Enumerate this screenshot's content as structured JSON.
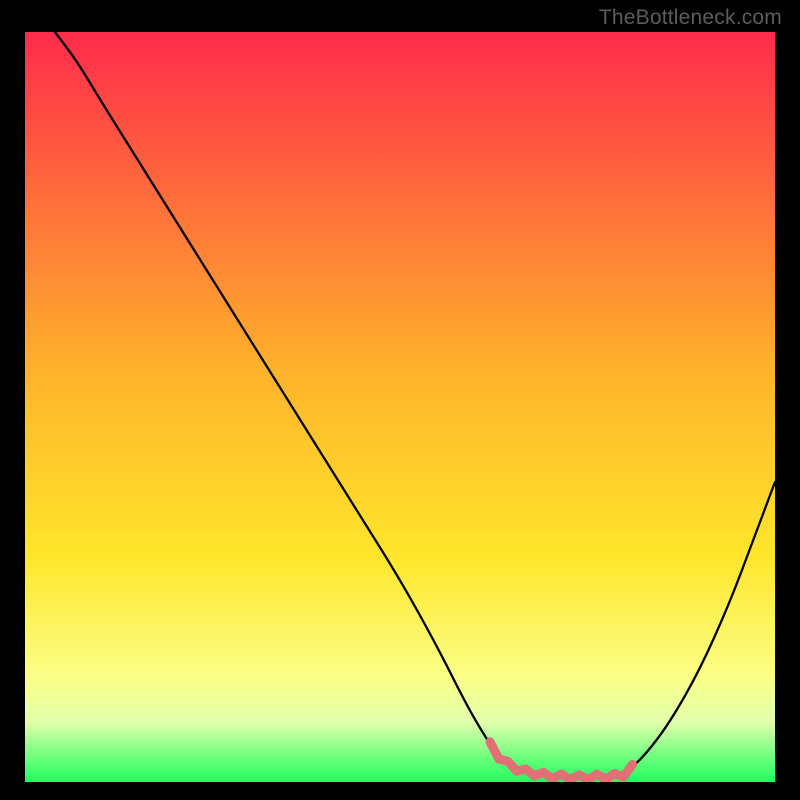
{
  "watermark": "TheBottleneck.com",
  "colors": {
    "gradient_stops": [
      {
        "offset": "0%",
        "color": "#ff2b4b"
      },
      {
        "offset": "45%",
        "color": "#ffb22b"
      },
      {
        "offset": "70%",
        "color": "#ffe62b"
      },
      {
        "offset": "86%",
        "color": "#fbff86"
      },
      {
        "offset": "92%",
        "color": "#e2ffac"
      },
      {
        "offset": "100%",
        "color": "#1dff5d"
      }
    ],
    "curve_stroke": "#000000",
    "valley_marker": "#e26e76"
  },
  "chart_data": {
    "type": "line",
    "title": "",
    "xlabel": "",
    "ylabel": "",
    "xlim": [
      0,
      100
    ],
    "ylim": [
      0,
      100
    ],
    "series": [
      {
        "name": "bottleneck-curve",
        "x": [
          4,
          7,
          10,
          15,
          20,
          25,
          30,
          35,
          40,
          45,
          50,
          55,
          59,
          62,
          63.5,
          65,
          67,
          70,
          74,
          79,
          80,
          81,
          83,
          86,
          90,
          94,
          97,
          100
        ],
        "y": [
          100,
          96,
          91,
          83,
          75,
          67,
          59,
          51,
          43,
          35,
          27,
          18,
          10,
          5,
          3,
          2,
          1.3,
          0.8,
          0.6,
          0.8,
          1.1,
          2,
          4,
          8,
          15,
          24,
          32,
          40
        ]
      }
    ],
    "valley_region": {
      "x_start": 62,
      "x_end": 81
    }
  }
}
